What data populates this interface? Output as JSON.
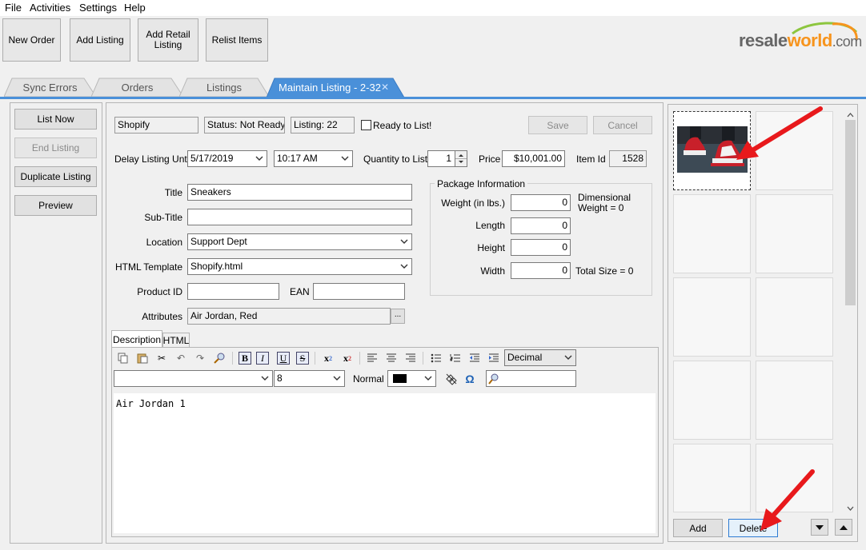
{
  "menu": [
    "File",
    "Activities",
    "Settings",
    "Help"
  ],
  "toolbar": {
    "new_order": "New Order",
    "add_listing": "Add Listing",
    "add_retail_listing": "Add Retail Listing",
    "relist_items": "Relist Items"
  },
  "logo": {
    "part1": "resale",
    "part2": "world",
    "part3": ".com"
  },
  "tabs": [
    "Sync Errors",
    "Orders",
    "Listings",
    "Maintain Listing - 2-32"
  ],
  "left_actions": {
    "list_now": "List Now",
    "end_listing": "End Listing",
    "duplicate_listing": "Duplicate Listing",
    "preview": "Preview"
  },
  "form": {
    "channel": "Shopify",
    "status": "Status: Not Ready",
    "listing": "Listing: 22",
    "ready_to_list": "Ready to List!",
    "save": "Save",
    "cancel": "Cancel",
    "delay_label": "Delay Listing Until",
    "delay_date": "5/17/2019",
    "delay_time": "10:17 AM",
    "qty_label": "Quantity to List",
    "qty_value": "1",
    "price_label": "Price",
    "price_value": "$10,001.00",
    "item_id_label": "Item Id",
    "item_id_value": "1528",
    "title_label": "Title",
    "title_value": "Sneakers",
    "subtitle_label": "Sub-Title",
    "subtitle_value": "",
    "location_label": "Location",
    "location_value": "Support Dept",
    "html_template_label": "HTML Template",
    "html_template_value": "Shopify.html",
    "product_id_label": "Product ID",
    "product_id_value": "",
    "ean_label": "EAN",
    "ean_value": "",
    "attributes_label": "Attributes",
    "attributes_value": "Air Jordan, Red",
    "ellipsis": "..."
  },
  "package": {
    "title": "Package Information",
    "weight_label": "Weight (in lbs.)",
    "weight_value": "0",
    "dimensional": "Dimensional",
    "dimensional_weight": "Weight = 0",
    "length_label": "Length",
    "length_value": "0",
    "height_label": "Height",
    "height_value": "0",
    "width_label": "Width",
    "width_value": "0",
    "total_size": "Total Size = 0"
  },
  "editor": {
    "tab_description": "Description",
    "tab_html": "HTML",
    "list_style": "Decimal",
    "font_family": "",
    "font_size": "8",
    "paragraph_style": "Normal",
    "color": "#000000",
    "content": "Air Jordan 1"
  },
  "images": {
    "add": "Add",
    "delete": "Delete"
  }
}
